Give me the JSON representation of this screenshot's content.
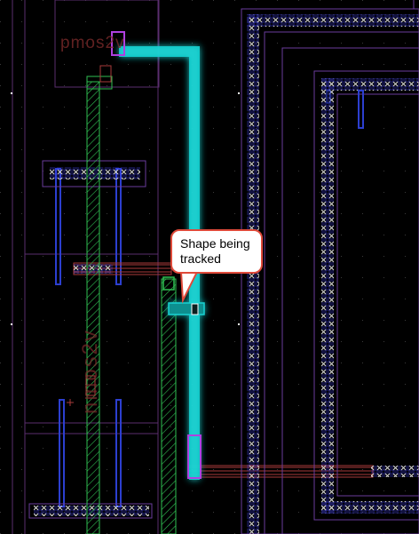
{
  "callout": {
    "text": "Shape being tracked"
  },
  "labels": {
    "pmos": "pmos2v",
    "nmos": "nmos2v"
  },
  "colors": {
    "background": "#000000",
    "highlight": "#19d3d3",
    "metal_purple": "#6a3c9c",
    "via_blue": "#2c3fd0",
    "poly_red": "#a83a3a",
    "diffusion_green": "#2fbf52",
    "callout_border": "#e04a3a"
  }
}
